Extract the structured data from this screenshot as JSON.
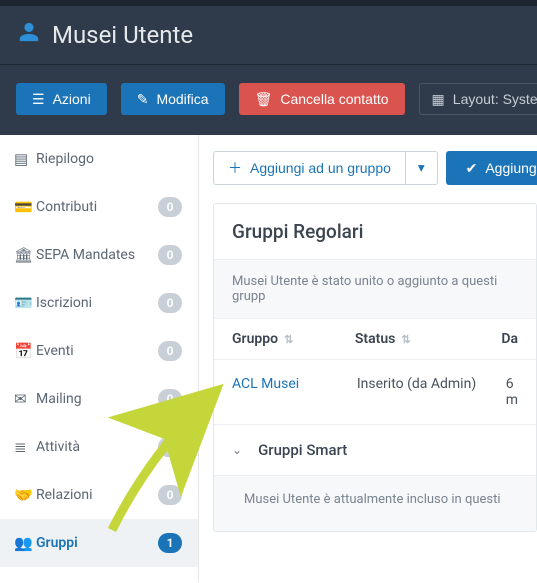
{
  "header": {
    "title": "Musei Utente"
  },
  "toolbar": {
    "actions_label": "Azioni",
    "edit_label": "Modifica",
    "delete_label": "Cancella contatto",
    "layout_label": "Layout: System Defa"
  },
  "sidebar": {
    "items": [
      {
        "key": "riepilogo",
        "label": "Riepilogo",
        "count": null
      },
      {
        "key": "contributi",
        "label": "Contributi",
        "count": "0"
      },
      {
        "key": "sepa",
        "label": "SEPA Mandates",
        "count": "0"
      },
      {
        "key": "iscrizioni",
        "label": "Iscrizioni",
        "count": "0"
      },
      {
        "key": "eventi",
        "label": "Eventi",
        "count": "0"
      },
      {
        "key": "mailing",
        "label": "Mailing",
        "count": "0"
      },
      {
        "key": "attivita",
        "label": "Attività",
        "count": "0"
      },
      {
        "key": "relazioni",
        "label": "Relazioni",
        "count": "0"
      },
      {
        "key": "gruppi",
        "label": "Gruppi",
        "count": "1"
      }
    ]
  },
  "content": {
    "add_to_group_label": "Aggiungi ad un gruppo",
    "add_label": "Aggiungi",
    "panel_title": "Gruppi Regolari",
    "panel_sub": "Musei Utente è stato unito o aggiunto a questi grupp",
    "columns": {
      "group": "Gruppo",
      "status": "Status",
      "date": "Da"
    },
    "row": {
      "group": "ACL Musei",
      "status": "Inserito (da Admin)",
      "date": "6 m"
    },
    "smart_panel_title": "Gruppi Smart",
    "smart_panel_sub": "Musei Utente è attualmente incluso in questi"
  }
}
